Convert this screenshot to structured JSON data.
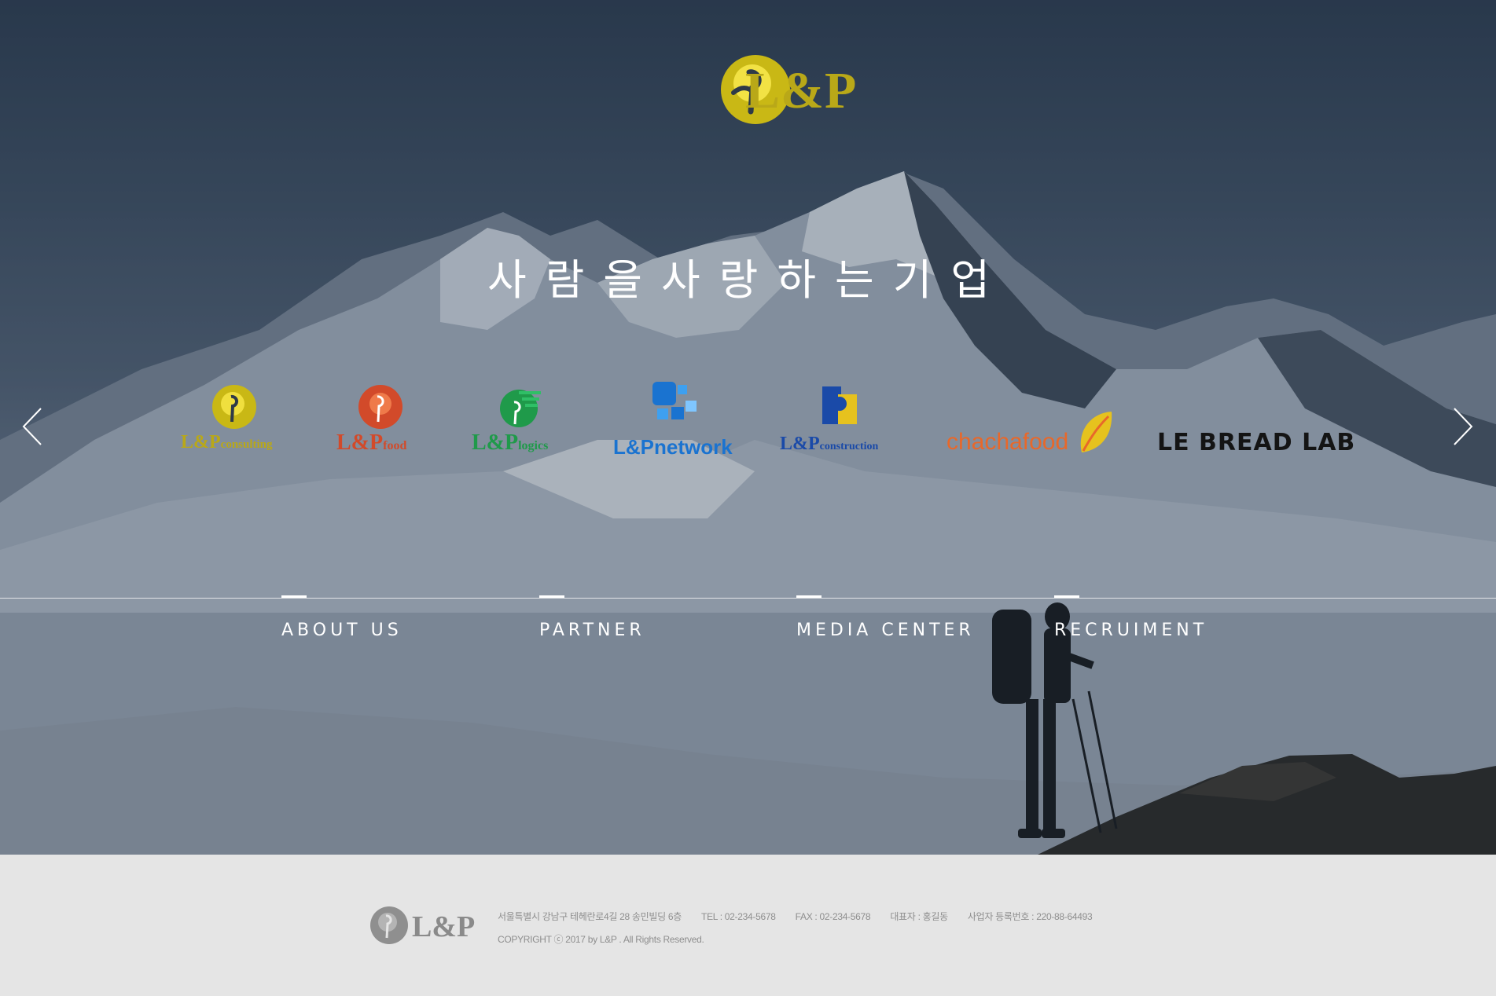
{
  "header": {
    "logo_text": "L&P"
  },
  "hero": {
    "slogan": "사람을사랑하는기업",
    "prev_arrow_icon": "chevron-left-icon",
    "next_arrow_icon": "chevron-right-icon"
  },
  "brands": [
    {
      "prefix": "L&P",
      "suffix": "consulting",
      "color": "#b9a818"
    },
    {
      "prefix": "L&P",
      "suffix": "food",
      "color": "#d24a2a"
    },
    {
      "prefix": "L&P",
      "suffix": "logics",
      "color": "#1f9a4a"
    },
    {
      "prefix": "L&P",
      "suffix": "network",
      "color": "#1a73d0"
    },
    {
      "prefix": "L&P",
      "suffix": "construction",
      "color": "#1a4aa8"
    },
    {
      "prefix": "chachafood",
      "suffix": "",
      "color": "#e8682a"
    },
    {
      "prefix": "LE BREAD LAB",
      "suffix": "",
      "color": "#141414"
    }
  ],
  "nav": [
    {
      "label": "ABOUT US"
    },
    {
      "label": "PARTNER"
    },
    {
      "label": "MEDIA CENTER"
    },
    {
      "label": "RECRUIMENT"
    }
  ],
  "footer": {
    "logo_text": "L&P",
    "address": "서울특별시 강남구 테헤란로4길 28 송민빌딩 6층",
    "tel": "TEL : 02-234-5678",
    "fax": "FAX : 02-234-5678",
    "ceo": "대표자 : 홍길동",
    "biz_no": "사업자 등록번호 : 220-88-64493",
    "copyright": "COPYRIGHT ⓒ 2017 by L&P . All Rights Reserved."
  },
  "colors": {
    "brand_gold": "#b9a818",
    "footer_bg": "#e5e5e5",
    "footer_text": "#8e8e8e"
  }
}
